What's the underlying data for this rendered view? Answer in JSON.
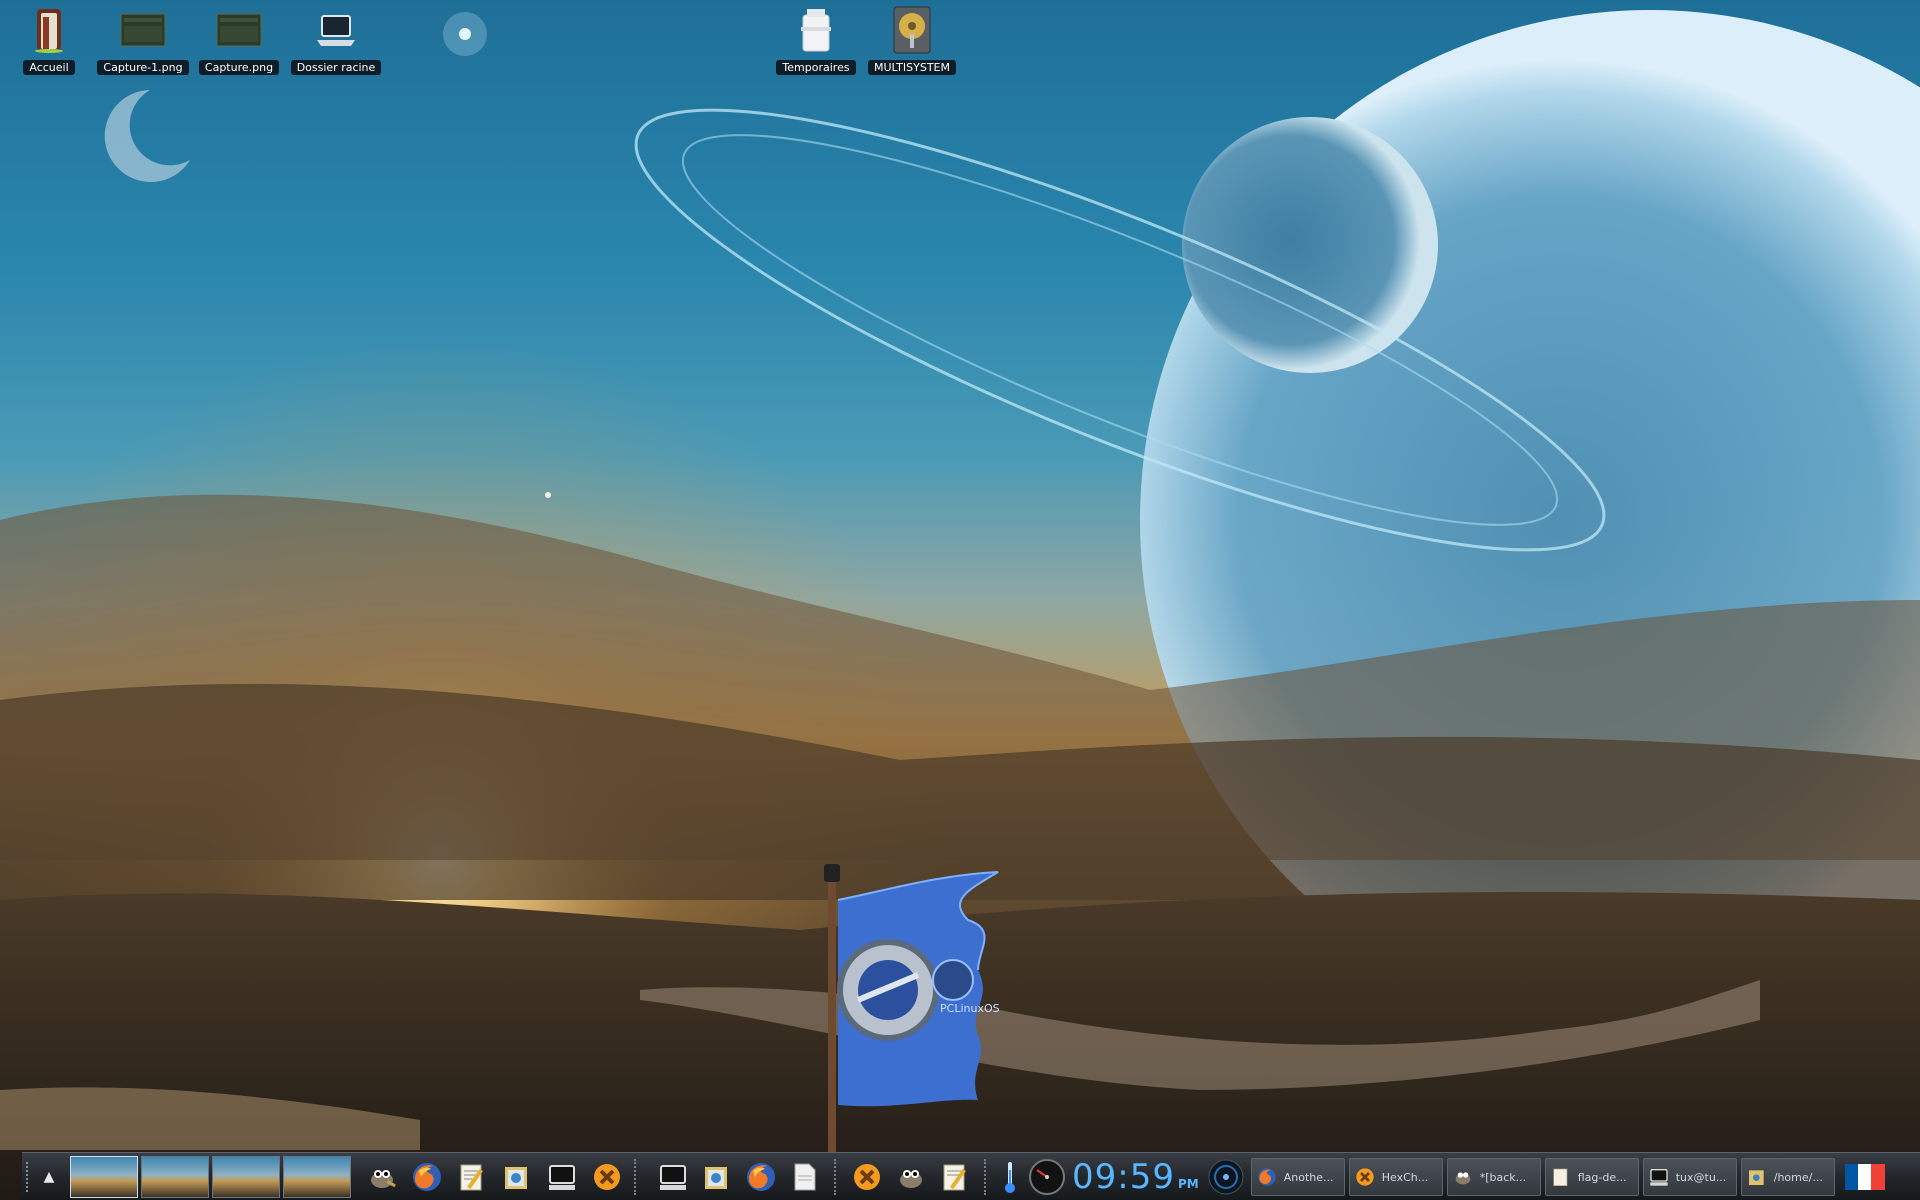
{
  "desktop": {
    "icons_left": [
      {
        "label": "Accueil",
        "icon": "home-door-icon"
      },
      {
        "label": "Capture-1.png",
        "icon": "image-thumbnail-icon"
      },
      {
        "label": "Capture.png",
        "icon": "image-thumbnail-icon"
      },
      {
        "label": "Dossier racine",
        "icon": "computer-root-icon"
      }
    ],
    "icons_right": [
      {
        "label": "Temporaires",
        "icon": "trash-icon"
      },
      {
        "label": "MULTISYSTEM",
        "icon": "hard-drive-icon"
      }
    ],
    "flag_logo_text": "PCLinuxOS"
  },
  "taskbar": {
    "pager_desktops": 4,
    "active_desktop": 1,
    "launchers": [
      "gimp-icon",
      "firefox-icon",
      "text-editor-icon",
      "file-manager-icon",
      "terminal-icon",
      "hexchat-icon"
    ],
    "launchers2": [
      "terminal-icon",
      "file-manager-icon",
      "firefox-icon",
      "document-icon",
      "hexchat-icon",
      "gimp-icon",
      "text-editor-icon",
      "thermometer-icon",
      "speedometer-icon"
    ],
    "clock": {
      "time": "09:59",
      "ampm": "PM"
    },
    "tasks": [
      {
        "label": "Anothe...",
        "icon": "firefox-icon"
      },
      {
        "label": "HexCh...",
        "icon": "hexchat-icon"
      },
      {
        "label": "*[back...",
        "icon": "gimp-icon"
      },
      {
        "label": "flag-de...",
        "icon": "text-editor-icon"
      },
      {
        "label": "tux@tu...",
        "icon": "terminal-icon"
      },
      {
        "label": "/home/...",
        "icon": "file-manager-icon"
      }
    ],
    "keyboard_layout": "fr-flag-icon",
    "colors": {
      "clock": "#58b7ff",
      "flag_blue": "#0055A4",
      "flag_white": "#FFFFFF",
      "flag_red": "#EF4135"
    }
  }
}
